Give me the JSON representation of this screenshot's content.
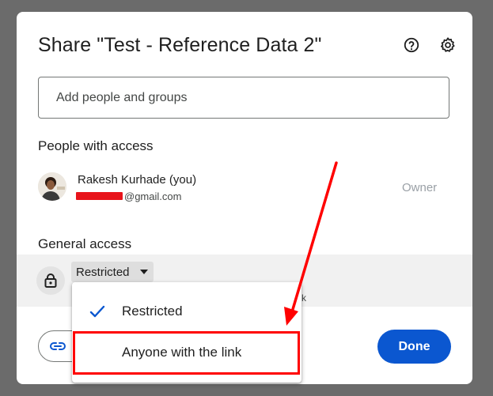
{
  "dialog": {
    "title": "Share \"Test - Reference Data 2\"",
    "help_icon": "help-circle-icon",
    "settings_icon": "gear-icon"
  },
  "add_people": {
    "placeholder": "Add people and groups",
    "value": ""
  },
  "people_section": {
    "heading": "People with access",
    "people": [
      {
        "name": "Rakesh Kurhade (you)",
        "email_visible": "@gmail.com",
        "role": "Owner"
      }
    ]
  },
  "general_access": {
    "heading": "General access",
    "selected": "Restricted",
    "lock_icon": "lock-icon",
    "trailing_text": "k"
  },
  "dropdown": {
    "options": [
      {
        "label": "Restricted",
        "checked": true
      },
      {
        "label": "Anyone with the link",
        "checked": false
      }
    ]
  },
  "footer": {
    "copy_link_icon": "link-icon",
    "done_label": "Done"
  },
  "colors": {
    "accent": "#0b57d0",
    "annotation": "#ff0000",
    "overlay": "#6b6b6b"
  }
}
